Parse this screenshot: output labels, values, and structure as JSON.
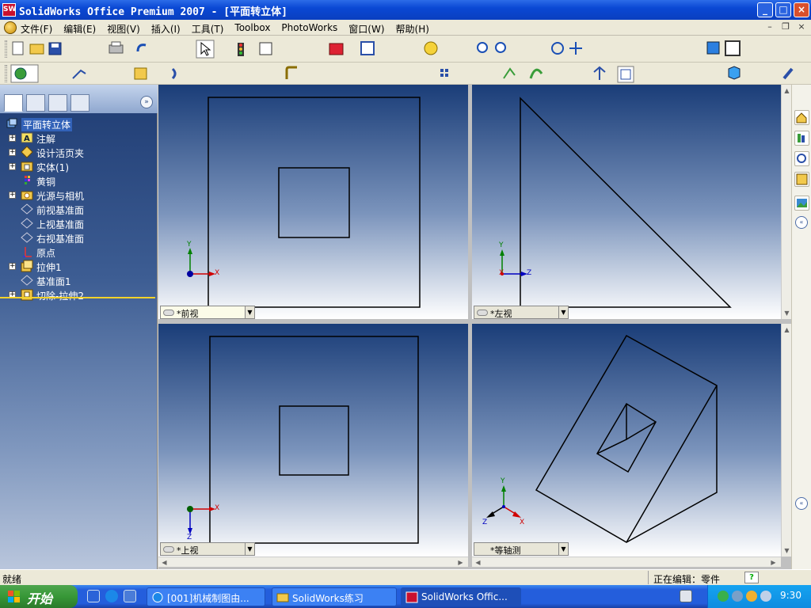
{
  "window": {
    "title": "SolidWorks Office Premium 2007 - [平面转立体]",
    "icon": "SW"
  },
  "menu": {
    "items": [
      "文件(F)",
      "编辑(E)",
      "视图(V)",
      "插入(I)",
      "工具(T)",
      "Toolbox",
      "PhotoWorks",
      "窗口(W)",
      "帮助(H)"
    ]
  },
  "feature_tree": {
    "root": "平面转立体",
    "items": [
      {
        "label": "注解",
        "icon": "annotation-icon"
      },
      {
        "label": "设计活页夹",
        "icon": "design-binder-icon"
      },
      {
        "label": "实体(1)",
        "icon": "solid-bodies-icon"
      },
      {
        "label": "黄铜",
        "icon": "material-icon"
      },
      {
        "label": "光源与相机",
        "icon": "lights-cameras-icon"
      },
      {
        "label": "前视基准面",
        "icon": "plane-icon"
      },
      {
        "label": "上视基准面",
        "icon": "plane-icon"
      },
      {
        "label": "右视基准面",
        "icon": "plane-icon"
      },
      {
        "label": "原点",
        "icon": "origin-icon"
      },
      {
        "label": "拉伸1",
        "icon": "extrude-icon"
      },
      {
        "label": "基准面1",
        "icon": "plane-icon"
      },
      {
        "label": "切除-拉伸2",
        "icon": "cut-extrude-icon"
      }
    ]
  },
  "viewports": {
    "front": {
      "label": "*前视",
      "axis_x": "X",
      "axis_y": "Y"
    },
    "left": {
      "label": "*左视",
      "axis_y": "Y",
      "axis_z": "Z",
      "axis_x": "X"
    },
    "top": {
      "label": "*上视",
      "axis_x": "X",
      "axis_z": "Z"
    },
    "iso": {
      "label": "*等轴测",
      "axis_x": "X",
      "axis_y": "Y",
      "axis_z": "Z"
    }
  },
  "status": {
    "ready": "就绪",
    "mode": "正在编辑：零件",
    "help": "?"
  },
  "taskbar": {
    "start": "开始",
    "tasks": [
      {
        "label": "[001]机械制图由...",
        "icon": "ie-icon"
      },
      {
        "label": "SolidWorks练习",
        "icon": "folder-icon"
      },
      {
        "label": "SolidWorks Offic...",
        "icon": "solidworks-icon"
      }
    ],
    "clock": "9:30"
  },
  "colors": {
    "titlebar": "#0a48d4",
    "viewport_top": "#1a3d78",
    "viewport_bottom": "#ffffff",
    "axis_x": "#d00000",
    "axis_y": "#008000",
    "axis_z": "#0000c0",
    "rollback": "#f2d22a"
  }
}
